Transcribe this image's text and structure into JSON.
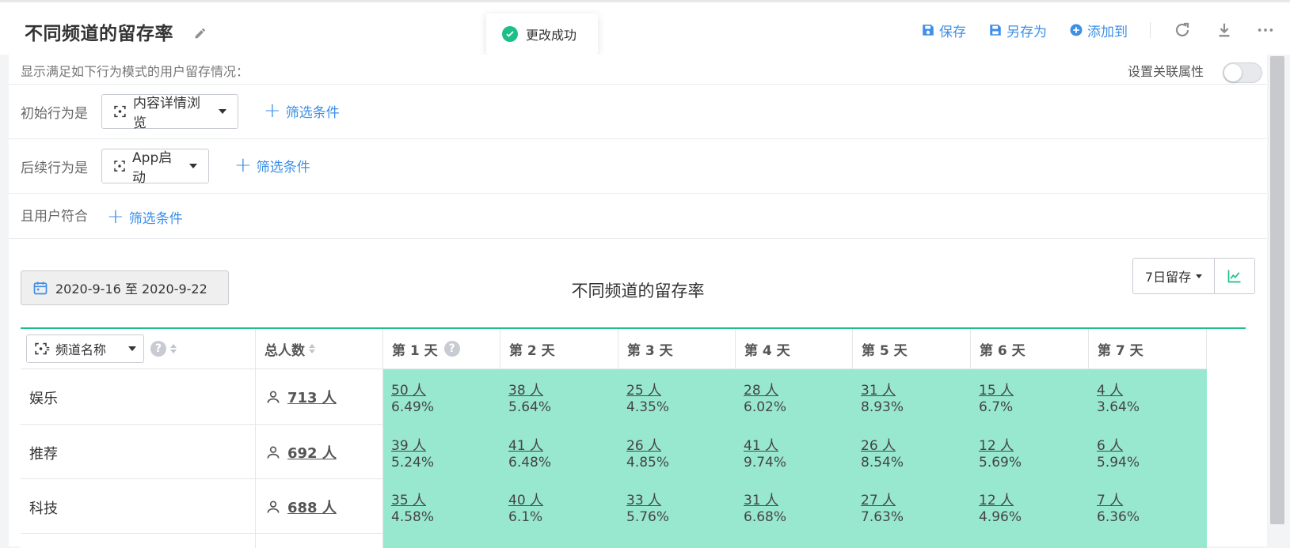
{
  "header": {
    "title": "不同频道的留存率",
    "toolbar": {
      "save": "保存",
      "save_as": "另存为",
      "add_to": "添加到"
    }
  },
  "toast": {
    "message": "更改成功"
  },
  "filters": {
    "description": "显示满足如下行为模式的用户留存情况：",
    "assoc_label": "设置关联属性",
    "initial_label": "初始行为是",
    "initial_value": "内容详情浏览",
    "followup_label": "后续行为是",
    "followup_value": "App启动",
    "user_label": "且用户符合",
    "filter_button": "筛选条件"
  },
  "report": {
    "date_range": "2020-9-16 至 2020-9-22",
    "chart_title": "不同频道的留存率",
    "retention_select": "7日留存"
  },
  "table": {
    "group_select": "频道名称",
    "total_header": "总人数",
    "day_headers": [
      "第 1 天",
      "第 2 天",
      "第 3 天",
      "第 4 天",
      "第 5 天",
      "第 6 天",
      "第 7 天"
    ],
    "rows": [
      {
        "name": "娱乐",
        "total": "713 人",
        "cells": [
          [
            "50 人",
            "6.49%"
          ],
          [
            "38 人",
            "5.64%"
          ],
          [
            "25 人",
            "4.35%"
          ],
          [
            "28 人",
            "6.02%"
          ],
          [
            "31 人",
            "8.93%"
          ],
          [
            "15 人",
            "6.7%"
          ],
          [
            "4 人",
            "3.64%"
          ]
        ]
      },
      {
        "name": "推荐",
        "total": "692 人",
        "cells": [
          [
            "39 人",
            "5.24%"
          ],
          [
            "41 人",
            "6.48%"
          ],
          [
            "26 人",
            "4.85%"
          ],
          [
            "41 人",
            "9.74%"
          ],
          [
            "26 人",
            "8.54%"
          ],
          [
            "12 人",
            "5.69%"
          ],
          [
            "6 人",
            "5.94%"
          ]
        ]
      },
      {
        "name": "科技",
        "total": "688 人",
        "cells": [
          [
            "35 人",
            "4.58%"
          ],
          [
            "40 人",
            "6.1%"
          ],
          [
            "33 人",
            "5.76%"
          ],
          [
            "31 人",
            "6.68%"
          ],
          [
            "27 人",
            "7.63%"
          ],
          [
            "12 人",
            "4.96%"
          ],
          [
            "7 人",
            "6.36%"
          ]
        ]
      }
    ]
  },
  "colors": {
    "accent": "#3d8fe8",
    "success": "#1cbf8a",
    "cell_green": "#98e8cf"
  }
}
